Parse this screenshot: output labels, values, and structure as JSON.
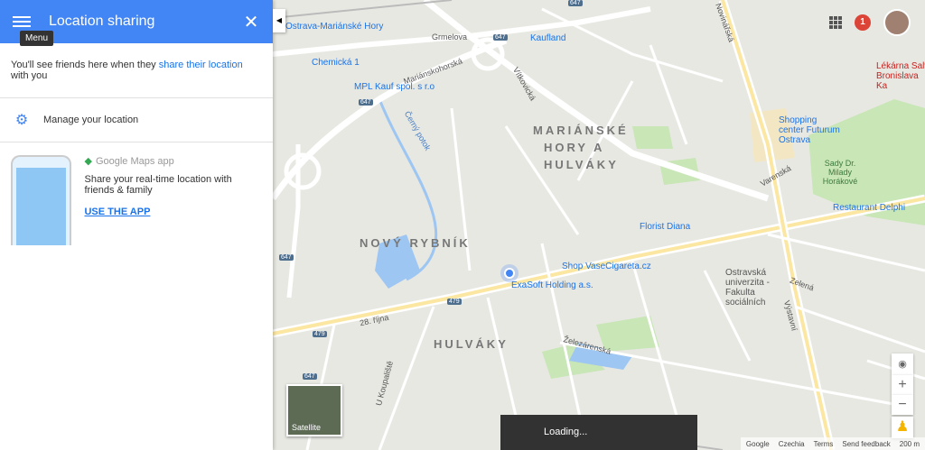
{
  "panel": {
    "menu_tooltip": "Menu",
    "title": "Location sharing",
    "info_prefix": "You'll see friends here when they ",
    "info_link": "share their location",
    "info_suffix": " with you",
    "manage_label": "Manage your location",
    "app_name": "Google Maps app",
    "app_desc": "Share your real-time location with friends & family",
    "use_app": "USE THE APP"
  },
  "map": {
    "districts": [
      "MARIÁNSKÉ",
      "HORY A",
      "HULVÁKY",
      "NOVÝ RYBNÍK",
      "HULVÁKY"
    ],
    "pois": [
      "Ostrava-Mariánské Hory",
      "Kaufland",
      "Chemická 1",
      "MPL Kauf spol. s r.o",
      "Shopping center Futurum Ostrava",
      "Lékárna Salv Bronislava Ka",
      "Sady Dr. Milady Horákové",
      "Restaurant Delphi",
      "Florist Diana",
      "Shop VaseCigareta.cz",
      "ExaSoft Holding a.s.",
      "Ostravská univerzita - Fakulta sociálních"
    ],
    "streets": [
      "Grmelova",
      "Mariánskohorská",
      "Černý potok",
      "28. října",
      "Železárenská",
      "Vítkovická",
      "Novinářská",
      "Výstavní",
      "Varenská",
      "U Koupaliště",
      "Zelená"
    ],
    "shields": [
      "647",
      "647",
      "647",
      "647",
      "479",
      "479",
      "647"
    ]
  },
  "topbar": {
    "notification_count": "1"
  },
  "controls": {
    "zoom_in": "+",
    "zoom_out": "−",
    "satellite_label": "Satellite"
  },
  "loading": "Loading...",
  "footer": {
    "google": "Google",
    "country": "Czechia",
    "terms": "Terms",
    "feedback": "Send feedback",
    "scale": "200 m"
  }
}
